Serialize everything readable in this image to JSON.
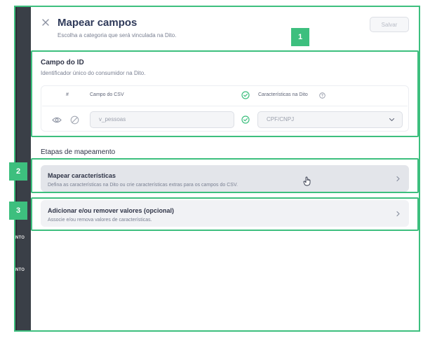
{
  "background": {
    "labels": [
      "NTO",
      "NTO"
    ]
  },
  "header": {
    "title": "Mapear campos",
    "subtitle": "Escolha a categoria que será vinculada na Dito.",
    "save_label": "Salvar"
  },
  "badges": [
    "1",
    "2",
    "3"
  ],
  "id_section": {
    "title": "Campo do ID",
    "subtitle": "Identificador único do consumidor na Dito.",
    "columns": {
      "number": "#",
      "csv_field": "Campo do CSV",
      "dito_characteristics": "Características na Dito"
    },
    "row": {
      "csv_value": "v_pessoas",
      "dito_value": "CPF/CNPJ"
    }
  },
  "steps": {
    "title": "Etapas de mapeamento",
    "items": [
      {
        "title": "Mapear características",
        "description": "Defina as características na Dito ou crie características extras para os campos do CSV."
      },
      {
        "title": "Adicionar e/ou remover valores (opcional)",
        "description": "Associe e/ou remova valores de características."
      }
    ]
  },
  "colors": {
    "accent_green": "#3dbf7e",
    "title_navy": "#2f3a5a",
    "background_strip": "#3a3f47"
  },
  "icons": [
    "close-icon",
    "check-circle-icon",
    "help-circle-icon",
    "eye-icon",
    "block-icon",
    "chevron-down-icon",
    "chevron-right-icon",
    "hand-cursor-icon"
  ]
}
